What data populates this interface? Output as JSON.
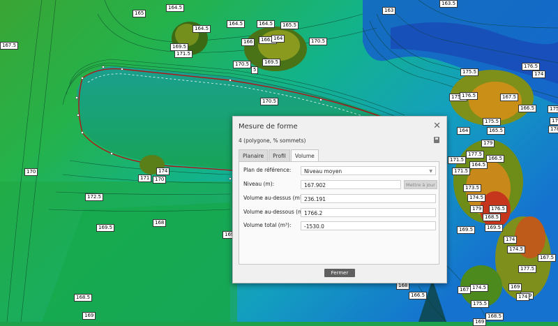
{
  "map": {
    "labels": [
      {
        "text": "165"
      },
      {
        "text": "164.5"
      },
      {
        "text": "163"
      },
      {
        "text": "163.5"
      },
      {
        "text": "164.5"
      },
      {
        "text": "164.5"
      },
      {
        "text": "164.5"
      },
      {
        "text": "165.5"
      },
      {
        "text": "166"
      },
      {
        "text": "166.5"
      },
      {
        "text": "164"
      },
      {
        "text": "170.5"
      },
      {
        "text": "169.5"
      },
      {
        "text": "171.5"
      },
      {
        "text": "169.5"
      },
      {
        "text": "170.5"
      },
      {
        "text": "5"
      },
      {
        "text": "167.5"
      },
      {
        "text": "170.5"
      },
      {
        "text": "175.5"
      },
      {
        "text": "176.5"
      },
      {
        "text": "174"
      },
      {
        "text": "175.5"
      },
      {
        "text": "176.5"
      },
      {
        "text": "167.5"
      },
      {
        "text": "166.5"
      },
      {
        "text": "175.5"
      },
      {
        "text": "164"
      },
      {
        "text": "165.5"
      },
      {
        "text": "179"
      },
      {
        "text": "177.5"
      },
      {
        "text": "164.5"
      },
      {
        "text": "166.5"
      },
      {
        "text": "171.5"
      },
      {
        "text": "171.5"
      },
      {
        "text": "174"
      },
      {
        "text": "171"
      },
      {
        "text": "170"
      },
      {
        "text": "170"
      },
      {
        "text": "172.5"
      },
      {
        "text": "173.5"
      },
      {
        "text": "174.5"
      },
      {
        "text": "179"
      },
      {
        "text": "176.5"
      },
      {
        "text": "168.5"
      },
      {
        "text": "169.5"
      },
      {
        "text": "169.5"
      },
      {
        "text": "168"
      },
      {
        "text": "169.5"
      },
      {
        "text": "169"
      },
      {
        "text": "168.5"
      },
      {
        "text": "169"
      },
      {
        "text": "168"
      },
      {
        "text": "166.5"
      },
      {
        "text": "167"
      },
      {
        "text": "174.5"
      },
      {
        "text": "175.5"
      },
      {
        "text": "174"
      },
      {
        "text": "174.5"
      },
      {
        "text": "177.5"
      },
      {
        "text": "169"
      },
      {
        "text": "169"
      },
      {
        "text": "168.5"
      },
      {
        "text": "169"
      },
      {
        "text": "167.5"
      },
      {
        "text": "175"
      },
      {
        "text": "178.5"
      },
      {
        "text": "174"
      },
      {
        "text": "175.5"
      }
    ]
  },
  "dialog": {
    "title": "Mesure de forme",
    "info": "4 (polygone, % sommets)",
    "tabs": [
      {
        "label": "Planaire"
      },
      {
        "label": "Profil"
      },
      {
        "label": "Volume"
      }
    ],
    "fields": {
      "reference_label": "Plan de référence:",
      "reference_value": "Niveau moyen",
      "level_label": "Niveau (m):",
      "level_value": "167.902",
      "update_label": "Mettre à jour",
      "above_label": "Volume au-dessus (m³):",
      "above_value": "236.191",
      "below_label": "Volume au-dessous (m³):",
      "below_value": "1766.2",
      "total_label": "Volume total (m³):",
      "total_value": "-1530.0"
    },
    "close_label": "Fermer"
  }
}
